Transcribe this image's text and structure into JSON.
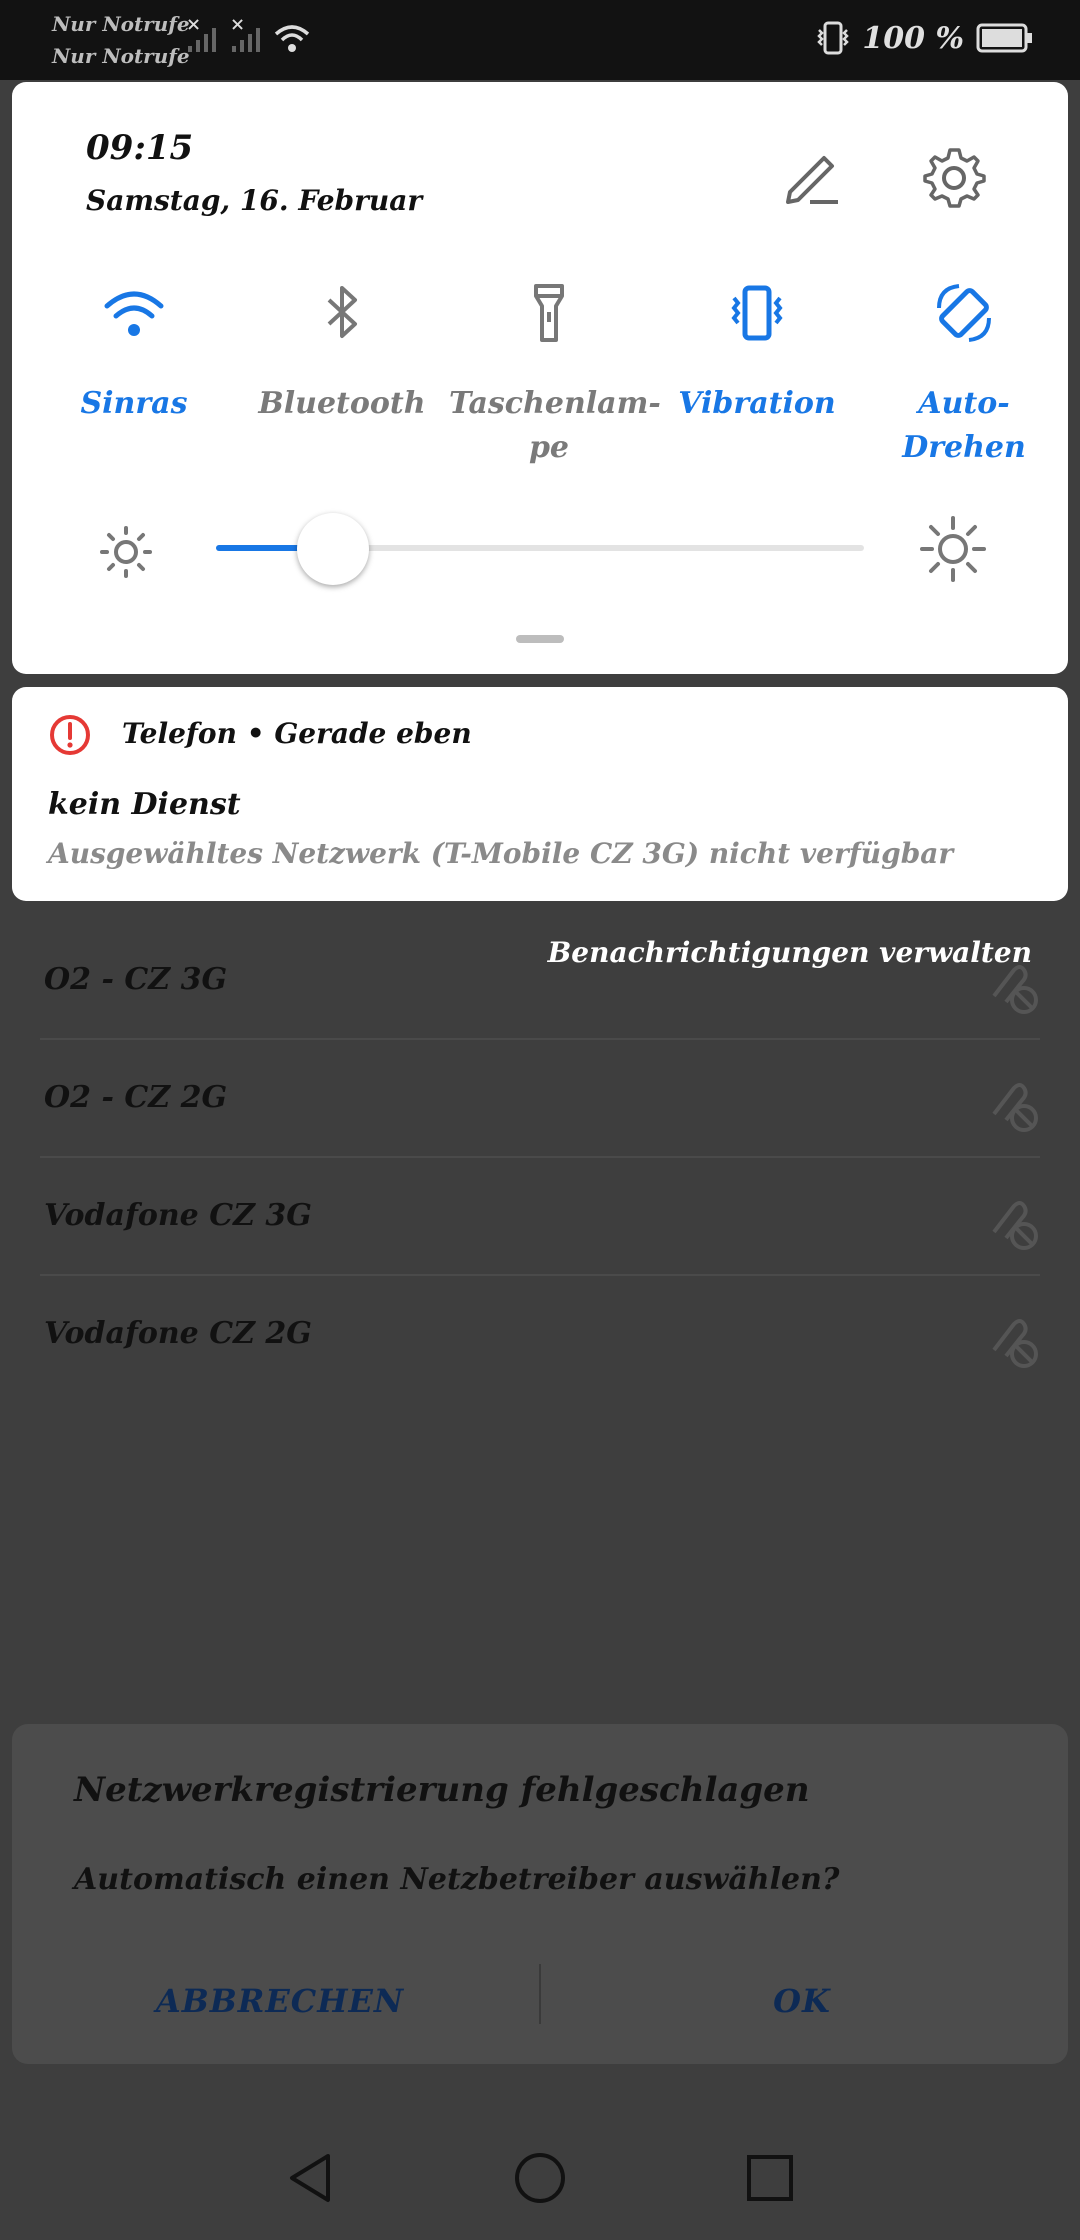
{
  "status_bar": {
    "carrier_1": "Nur Notrufe",
    "carrier_2": "Nur Notrufe",
    "battery_percent": "100 %"
  },
  "quick_settings": {
    "time": "09:15",
    "date": "Samstag, 16. Februar",
    "tiles": [
      {
        "label": "Sinras",
        "icon": "wifi-icon",
        "active": true
      },
      {
        "label": "Bluetooth",
        "icon": "bluetooth-icon",
        "active": false
      },
      {
        "label": "Taschenlam-\npe",
        "icon": "flashlight-icon",
        "active": false
      },
      {
        "label": "Vibration",
        "icon": "vibration-icon",
        "active": true
      },
      {
        "label": "Auto-Drehen",
        "icon": "auto-rotate-icon",
        "active": true
      }
    ],
    "brightness_level": 0.18
  },
  "notification": {
    "app": "Telefon • Gerade eben",
    "title": "kein Dienst",
    "text": "Ausgewähltes Netzwerk (T-Mobile CZ 3G) nicht verfügbar"
  },
  "manage_notifications": "Benachrichtigungen verwalten",
  "networks": [
    {
      "label": "O2 - CZ 3G"
    },
    {
      "label": "O2 - CZ 2G"
    },
    {
      "label": "Vodafone CZ 3G"
    },
    {
      "label": "Vodafone CZ 2G"
    }
  ],
  "dialog": {
    "title": "Netzwerkregistrierung fehlgeschlagen",
    "message": "Automatisch einen Netzbetreiber auswählen?",
    "cancel_label": "ABBRECHEN",
    "ok_label": "OK"
  },
  "colors": {
    "accent": "#1877e5",
    "error": "#e53935",
    "dialog_button": "#0d2a55"
  }
}
